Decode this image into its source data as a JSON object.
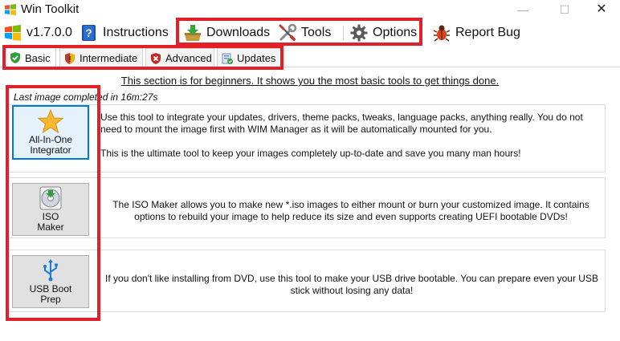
{
  "window": {
    "title": "Win Toolkit",
    "controls": {
      "minimize": "—",
      "maximize": "☐",
      "close": "✕"
    }
  },
  "menu": {
    "version": {
      "label": "v1.7.0.0",
      "icon": "windows-logo-icon"
    },
    "instructions": {
      "label": "Instructions",
      "icon": "help-book-icon"
    },
    "downloads": {
      "label": "Downloads",
      "icon": "download-box-icon"
    },
    "tools": {
      "label": "Tools",
      "icon": "wrench-screwdriver-icon"
    },
    "options": {
      "label": "Options",
      "icon": "gear-icon"
    },
    "report_bug": {
      "label": "Report Bug",
      "icon": "bug-icon"
    }
  },
  "tabs": [
    {
      "label": "Basic",
      "icon": "green-shield-icon",
      "active": true
    },
    {
      "label": "Intermediate",
      "icon": "yellow-shield-icon",
      "active": false
    },
    {
      "label": "Advanced",
      "icon": "red-shield-icon",
      "active": false
    },
    {
      "label": "Updates",
      "icon": "updates-icon",
      "active": false
    }
  ],
  "content": {
    "intro": "This section is for beginners. It shows you the most basic tools to get things done.",
    "last_image": "Last image completed in 16m:27s",
    "tools": [
      {
        "button_label": "All-In-One\nIntegrator",
        "icon": "star-icon",
        "desc_1": "Use this tool to integrate your updates, drivers, theme packs, tweaks, language packs, anything really. You do not need to mount the image first with WIM Manager as it will be automatically mounted for you.",
        "desc_2": "This is the ultimate tool to keep your images completely up-to-date and save you many man hours!"
      },
      {
        "button_label": "ISO\nMaker",
        "icon": "disc-icon",
        "desc_1": "The ISO Maker allows you to make new *.iso images to either mount or burn your customized image. It contains options to rebuild your image to help reduce its size and even supports creating UEFI bootable DVDs!"
      },
      {
        "button_label": "USB Boot\nPrep",
        "icon": "usb-icon",
        "desc_1": "If you don't like installing from DVD, use this tool to make your USB drive bootable. You can prepare even your USB stick without losing any data!"
      }
    ]
  },
  "colors": {
    "highlight": "#e2202a",
    "focus_border": "#0078d7"
  }
}
